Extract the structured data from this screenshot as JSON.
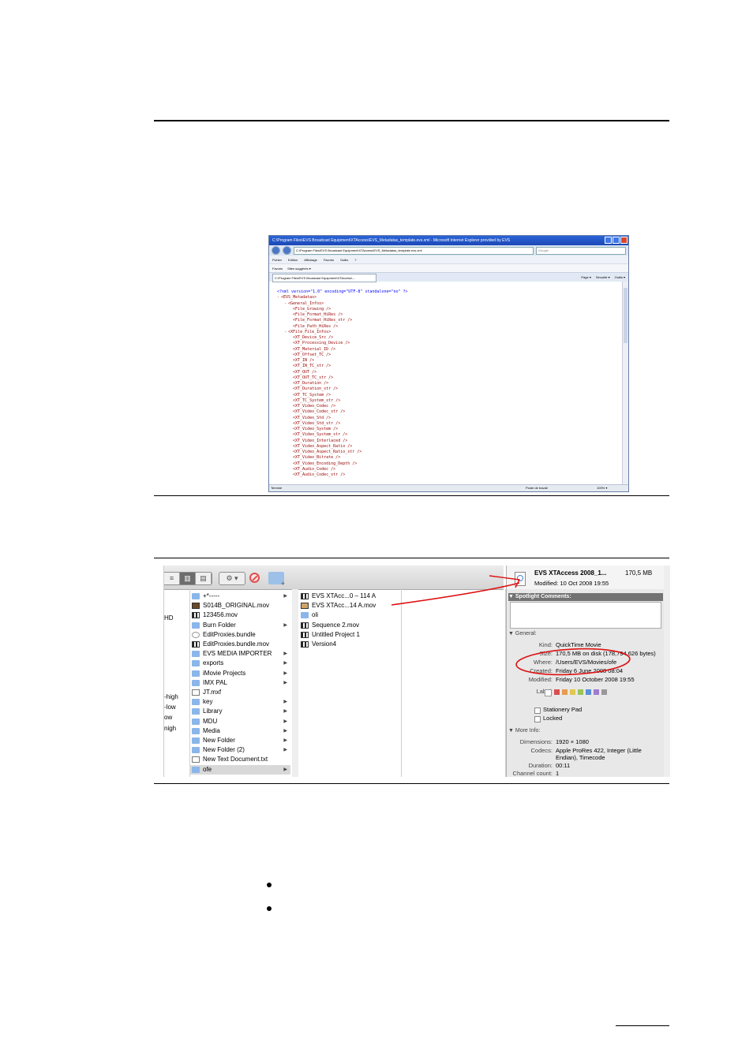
{
  "ie": {
    "window_title": "C:\\Program Files\\EVS Broadcast Equipment\\XTAccess\\EVS_Metadatas_template.evs.xml - Microsoft Internet Explorer provided by EVS",
    "address": "C:\\Program Files\\EVS Broadcast Equipment\\XTAccess\\EVS_Metadatas_template.evs.xml",
    "search_placeholder": "Google",
    "menu": [
      "Fichier",
      "Edition",
      "Affichage",
      "Favoris",
      "Outils",
      "?"
    ],
    "favorites": [
      "Favoris",
      "Sites suggérés ▾"
    ],
    "tab_title": "C:\\Program Files\\EVS Broadcast Equipment\\XTAccess\\...",
    "tab_tools": [
      "Page ▾",
      "Sécurité ▾",
      "Outils ▾"
    ],
    "xml_declaration": "<?xml version=\"1.0\" encoding=\"UTF-8\" standalone=\"no\" ?>",
    "xml_lines": [
      {
        "indent": 0,
        "minus": "-",
        "text": "<EVS_Metadatas>"
      },
      {
        "indent": 1,
        "minus": "-",
        "text": "<General_Infos>"
      },
      {
        "indent": 2,
        "minus": "",
        "text": "<File_Growing />"
      },
      {
        "indent": 2,
        "minus": "",
        "text": "<File_Format_HiRes />"
      },
      {
        "indent": 2,
        "minus": "",
        "text": "<File_Format_HiRes_str />"
      },
      {
        "indent": 2,
        "minus": "",
        "text": "<File_Path_HiRes />"
      },
      {
        "indent": 1,
        "minus": "-",
        "text": "<XFile_File_Infos>"
      },
      {
        "indent": 2,
        "minus": "",
        "text": "<XT_Device_Src />"
      },
      {
        "indent": 2,
        "minus": "",
        "text": "<XT_Processing_Device />"
      },
      {
        "indent": 2,
        "minus": "",
        "text": "<XT_Material_ID />"
      },
      {
        "indent": 2,
        "minus": "",
        "text": "<XT_Offset_TC />"
      },
      {
        "indent": 2,
        "minus": "",
        "text": "<XT_IN />"
      },
      {
        "indent": 2,
        "minus": "",
        "text": "<XT_IN_TC_str />"
      },
      {
        "indent": 2,
        "minus": "",
        "text": "<XT_OUT />"
      },
      {
        "indent": 2,
        "minus": "",
        "text": "<XT_OUT_TC_str />"
      },
      {
        "indent": 2,
        "minus": "",
        "text": "<XT_Duration />"
      },
      {
        "indent": 2,
        "minus": "",
        "text": "<XT_Duration_str />"
      },
      {
        "indent": 2,
        "minus": "",
        "text": "<XT_TC_System />"
      },
      {
        "indent": 2,
        "minus": "",
        "text": "<XT_TC_System_str />"
      },
      {
        "indent": 2,
        "minus": "",
        "text": "<XT_Video_Codec />"
      },
      {
        "indent": 2,
        "minus": "",
        "text": "<XT_Video_Codec_str />"
      },
      {
        "indent": 2,
        "minus": "",
        "text": "<XT_Video_Std />"
      },
      {
        "indent": 2,
        "minus": "",
        "text": "<XT_Video_Std_str />"
      },
      {
        "indent": 2,
        "minus": "",
        "text": "<XT_Video_System />"
      },
      {
        "indent": 2,
        "minus": "",
        "text": "<XT_Video_System_str />"
      },
      {
        "indent": 2,
        "minus": "",
        "text": "<XT_Video_Interlaced />"
      },
      {
        "indent": 2,
        "minus": "",
        "text": "<XT_Video_Aspect_Ratio />"
      },
      {
        "indent": 2,
        "minus": "",
        "text": "<XT_Video_Aspect_Ratio_str />"
      },
      {
        "indent": 2,
        "minus": "",
        "text": "<XT_Video_Bitrate />"
      },
      {
        "indent": 2,
        "minus": "",
        "text": "<XT_Video_Encoding_Depth />"
      },
      {
        "indent": 2,
        "minus": "",
        "text": "<XT_Audio_Codec />"
      },
      {
        "indent": 2,
        "minus": "",
        "text": "<XT_Audio_Codec_str />"
      }
    ],
    "status_left": "Terminé",
    "status_zone": "Poste de travail",
    "status_zoom": "100% ▾"
  },
  "finder": {
    "col0_fragments": [
      "HD",
      "-high",
      "-low",
      "ow",
      "nigh"
    ],
    "col1_items": [
      {
        "label": "+*-----",
        "icon": "folder-icon",
        "arrow": true
      },
      {
        "label": "S014B_ORIGINAL.mov",
        "icon": "movie-icon",
        "arrow": false
      },
      {
        "label": "123456.mov",
        "icon": "clapper-icon",
        "arrow": false
      },
      {
        "label": "Burn Folder",
        "icon": "burn-folder-icon",
        "arrow": true
      },
      {
        "label": "EditProxies.bundle",
        "icon": "bundle-icon",
        "arrow": false
      },
      {
        "label": "EditProxies.bundle.mov",
        "icon": "clapper-icon",
        "arrow": false
      },
      {
        "label": "EVS MEDIA IMPORTER",
        "icon": "folder-icon",
        "arrow": true
      },
      {
        "label": "exports",
        "icon": "folder-icon",
        "arrow": true
      },
      {
        "label": "iMovie Projects",
        "icon": "folder-icon",
        "arrow": true
      },
      {
        "label": "IMX PAL",
        "icon": "folder-icon",
        "arrow": true
      },
      {
        "label": "JT.mxf",
        "icon": "document-icon",
        "arrow": false
      },
      {
        "label": "key",
        "icon": "folder-icon",
        "arrow": true
      },
      {
        "label": "Library",
        "icon": "folder-icon",
        "arrow": true
      },
      {
        "label": "MDU",
        "icon": "folder-icon",
        "arrow": true
      },
      {
        "label": "Media",
        "icon": "folder-icon",
        "arrow": true
      },
      {
        "label": "New Folder",
        "icon": "folder-icon",
        "arrow": true
      },
      {
        "label": "New Folder (2)",
        "icon": "folder-icon",
        "arrow": true
      },
      {
        "label": "New Text Document.txt",
        "icon": "document-icon",
        "arrow": false
      },
      {
        "label": "ofe",
        "icon": "folder-icon",
        "arrow": true,
        "selected": true
      }
    ],
    "col2_items": [
      {
        "label": "EVS XTAcc...0 – 114 A",
        "icon": "clapper-icon"
      },
      {
        "label": "EVS XTAcc...14 A.mov",
        "icon": "movie-icon"
      },
      {
        "label": "oli",
        "icon": "folder-icon"
      },
      {
        "label": "Sequence 2.mov",
        "icon": "clapper-icon"
      },
      {
        "label": "Untitled Project 1",
        "icon": "clapper-icon"
      },
      {
        "label": "Version4",
        "icon": "clapper-icon"
      }
    ],
    "info": {
      "name": "EVS XTAccess 2008_1...",
      "size": "170,5 MB",
      "modified_line": "Modified: 10 Oct 2008 19:55",
      "spotlight_header": "Spotlight Comments:",
      "general_header": "General:",
      "general": [
        {
          "k": "Kind:",
          "v": "QuickTime Movie"
        },
        {
          "k": "Size:",
          "v": "170,5 MB on disk (178,794,626 bytes)"
        },
        {
          "k": "Where:",
          "v": "/Users/EVS/Movies/ofe"
        },
        {
          "k": "Created:",
          "v": "Friday 6 June 2008 08:04"
        },
        {
          "k": "Modified:",
          "v": "Friday 10 October 2008 19:55"
        },
        {
          "k": "Label:",
          "v": ""
        }
      ],
      "label_colors": [
        "#d94f4f",
        "#e89a4f",
        "#e0c84f",
        "#9cc45a",
        "#5a8fd9",
        "#a07ad0",
        "#999999"
      ],
      "stationery_label": "Stationery Pad",
      "locked_label": "Locked",
      "more_header": "More Info:",
      "more": [
        {
          "k": "Dimensions:",
          "v": "1920 × 1080"
        },
        {
          "k": "Codecs:",
          "v": "Apple ProRes 422, Integer (Little"
        },
        {
          "k": "",
          "v": "Endian), Timecode"
        },
        {
          "k": "Duration:",
          "v": "00:11"
        },
        {
          "k": "Channel count:",
          "v": "1"
        }
      ]
    },
    "annotation_color": "#dd1111"
  }
}
